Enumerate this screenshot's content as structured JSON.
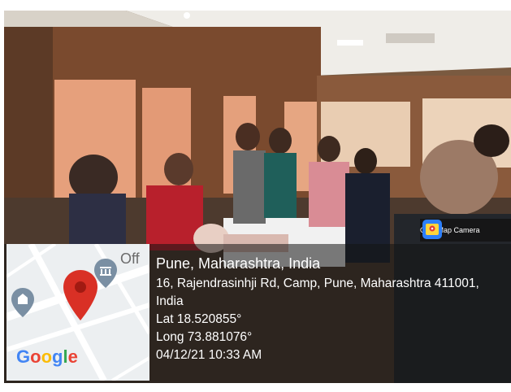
{
  "badge": {
    "label": "GPS Map Camera",
    "icon": "gps-map-camera-icon"
  },
  "map": {
    "brand": "Google",
    "brand_colors": [
      "#4285F4",
      "#EA4335",
      "#FBBC05",
      "#4285F4",
      "#34A853",
      "#EA4335"
    ],
    "pin_color": "#D93025",
    "poi_color": "#7A8FA3",
    "partial_label": "Off"
  },
  "location": {
    "title": "Pune, Maharashtra, India",
    "address_line1": "16, Rajendrasinhji Rd, Camp, Pune, Maharashtra 411001,",
    "address_line2": "India",
    "lat": "Lat 18.520855°",
    "long": "Long 73.881076°",
    "datetime": "04/12/21 10:33 AM"
  },
  "colors": {
    "wall": "#7a4a30",
    "curtain": "#e8a17e",
    "ceiling": "#f2f0ec",
    "overlay": "#141414"
  }
}
